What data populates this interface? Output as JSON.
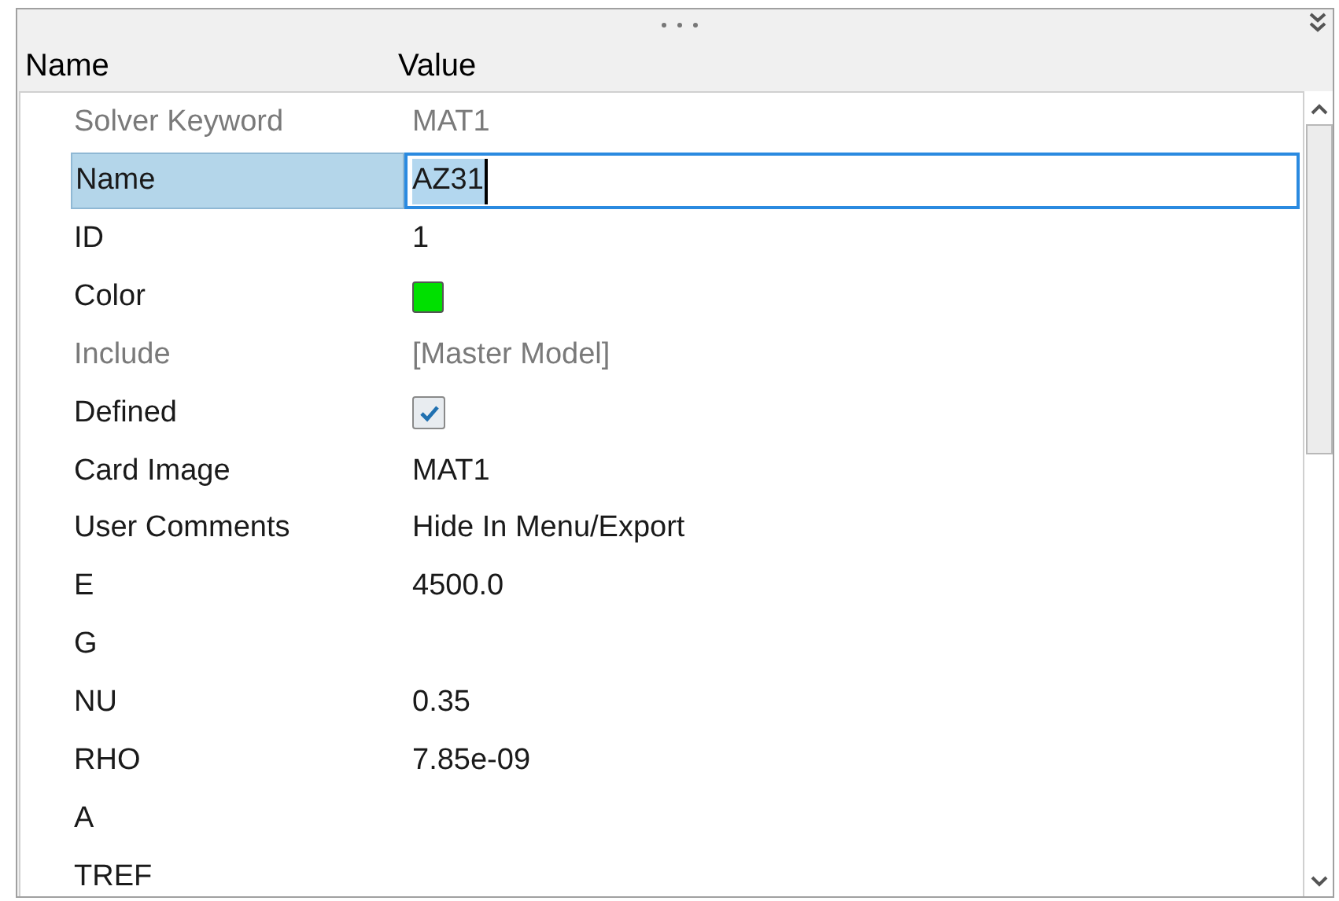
{
  "columns": [
    "Name",
    "Value"
  ],
  "rows": [
    {
      "name": "Solver Keyword",
      "kind": "text",
      "value": "MAT1",
      "disabled": true,
      "selected": false
    },
    {
      "name": "Name",
      "kind": "input",
      "value": "AZ31",
      "disabled": false,
      "selected": true
    },
    {
      "name": "ID",
      "kind": "text",
      "value": "1",
      "disabled": false,
      "selected": false
    },
    {
      "name": "Color",
      "kind": "color",
      "color": "#00e000",
      "disabled": false,
      "selected": false
    },
    {
      "name": "Include",
      "kind": "text",
      "value": "[Master Model]",
      "disabled": true,
      "selected": false
    },
    {
      "name": "Defined",
      "kind": "checkbox",
      "checked": true,
      "disabled": false,
      "selected": false
    },
    {
      "name": "Card Image",
      "kind": "text",
      "value": "MAT1",
      "disabled": false,
      "selected": false
    },
    {
      "name": "User Comments",
      "kind": "text",
      "value": "Hide In Menu/Export",
      "disabled": false,
      "selected": false
    },
    {
      "name": "E",
      "kind": "text",
      "value": "4500.0",
      "disabled": false,
      "selected": false
    },
    {
      "name": "G",
      "kind": "text",
      "disabled": false,
      "selected": false
    },
    {
      "name": "NU",
      "kind": "text",
      "value": "0.35",
      "disabled": false,
      "selected": false
    },
    {
      "name": "RHO",
      "kind": "text",
      "value": "7.85e-09",
      "disabled": false,
      "selected": false
    },
    {
      "name": "A",
      "kind": "text",
      "disabled": false,
      "selected": false
    },
    {
      "name": "TREF",
      "kind": "text",
      "disabled": false,
      "selected": false
    }
  ]
}
